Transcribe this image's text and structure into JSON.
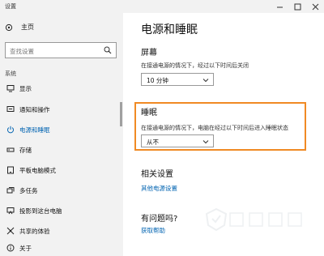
{
  "window": {
    "title": "设置"
  },
  "sidebar": {
    "home_label": "主页",
    "search_placeholder": "查找设置",
    "section_label": "系统",
    "items": [
      {
        "label": "显示",
        "icon": "monitor-icon"
      },
      {
        "label": "通知和操作",
        "icon": "notification-icon"
      },
      {
        "label": "电源和睡眠",
        "icon": "power-icon",
        "active": true
      },
      {
        "label": "存储",
        "icon": "storage-icon"
      },
      {
        "label": "平板电脑模式",
        "icon": "tablet-mode-icon"
      },
      {
        "label": "多任务",
        "icon": "multitasking-icon"
      },
      {
        "label": "投影到这台电脑",
        "icon": "project-icon"
      },
      {
        "label": "共享的体验",
        "icon": "shared-experiences-icon"
      },
      {
        "label": "关于",
        "icon": "info-icon"
      }
    ]
  },
  "main": {
    "page_title": "电源和睡眠",
    "screen": {
      "heading": "屏幕",
      "description": "在接通电源的情况下，经过以下时间后关闭",
      "value": "10 分钟"
    },
    "sleep": {
      "heading": "睡眠",
      "description": "在接通电源的情况下，电脑在经过以下时间后进入睡眠状态",
      "value": "从不"
    },
    "related": {
      "heading": "相关设置",
      "link": "其他电源设置"
    },
    "questions": {
      "heading": "有问题吗?",
      "link": "获取帮助"
    }
  },
  "colors": {
    "accent": "#0063b1",
    "highlight_border": "#f08a24"
  }
}
